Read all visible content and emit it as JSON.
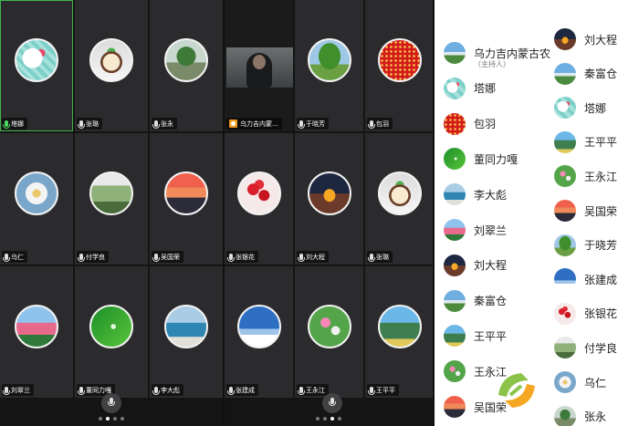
{
  "colors": {
    "active_border": "#3fb34f",
    "host_badge": "#f29b1d",
    "speaking_mic": "#4cd964"
  },
  "panel1": {
    "tiles": [
      {
        "name": "塔娜",
        "image": "img-kitty",
        "active": true,
        "mic": "speaking"
      },
      {
        "name": "张璐",
        "image": "img-food",
        "mic": "idle"
      },
      {
        "name": "张永",
        "image": "img-park",
        "mic": "idle"
      },
      {
        "name": "乌仁",
        "image": "img-flower",
        "mic": "idle"
      },
      {
        "name": "付学良",
        "image": "img-city",
        "mic": "idle"
      },
      {
        "name": "吴国荣",
        "image": "img-sunset",
        "mic": "idle"
      },
      {
        "name": "刘翠兰",
        "image": "img-field",
        "mic": "idle"
      },
      {
        "name": "董同力嘎",
        "image": "img-leaf",
        "mic": "idle"
      },
      {
        "name": "李大彪",
        "image": "img-lake",
        "mic": "idle"
      }
    ],
    "page_dots": 4,
    "active_dot": 1
  },
  "panel2": {
    "tiles": [
      {
        "name": "乌力吉内蒙...",
        "video": true,
        "mic": "host"
      },
      {
        "name": "于晓芳",
        "image": "img-tree",
        "mic": "idle"
      },
      {
        "name": "包羽",
        "image": "img-red",
        "mic": "idle"
      },
      {
        "name": "张银花",
        "image": "img-roses",
        "mic": "idle"
      },
      {
        "name": "刘大程",
        "image": "img-bridge",
        "mic": "idle"
      },
      {
        "name": "张璐",
        "image": "img-food",
        "mic": "idle"
      },
      {
        "name": "张建成",
        "image": "img-sky",
        "mic": "idle"
      },
      {
        "name": "王永江",
        "image": "img-cosmos",
        "mic": "idle"
      },
      {
        "name": "王平平",
        "image": "img-valley",
        "mic": "idle"
      }
    ],
    "page_dots": 4,
    "active_dot": 2
  },
  "participants_left": [
    {
      "name": "乌力吉内蒙古农",
      "role": "（主持人）",
      "image": "img-mount"
    },
    {
      "name": "塔娜",
      "image": "img-kitty"
    },
    {
      "name": "包羽",
      "image": "img-red"
    },
    {
      "name": "董同力嘎",
      "image": "img-leaf"
    },
    {
      "name": "李大彪",
      "image": "img-lake"
    },
    {
      "name": "刘翠兰",
      "image": "img-field"
    },
    {
      "name": "刘大程",
      "image": "img-bridge"
    },
    {
      "name": "秦富仓",
      "image": "img-mount"
    },
    {
      "name": "王平平",
      "image": "img-valley"
    },
    {
      "name": "王永江",
      "image": "img-cosmos"
    },
    {
      "name": "吴国荣",
      "image": "img-sunset"
    }
  ],
  "participants_right": [
    {
      "name": "刘大程",
      "image": "img-bridge"
    },
    {
      "name": "秦富仓",
      "image": "img-mount"
    },
    {
      "name": "塔娜",
      "image": "img-kitty"
    },
    {
      "name": "王平平",
      "image": "img-valley"
    },
    {
      "name": "王永江",
      "image": "img-cosmos"
    },
    {
      "name": "吴国荣",
      "image": "img-sunset"
    },
    {
      "name": "于晓芳",
      "image": "img-tree"
    },
    {
      "name": "张建成",
      "image": "img-sky"
    },
    {
      "name": "张银花",
      "image": "img-roses"
    },
    {
      "name": "付学良",
      "image": "img-city"
    },
    {
      "name": "乌仁",
      "image": "img-flower"
    },
    {
      "name": "张永",
      "image": "img-park"
    }
  ]
}
